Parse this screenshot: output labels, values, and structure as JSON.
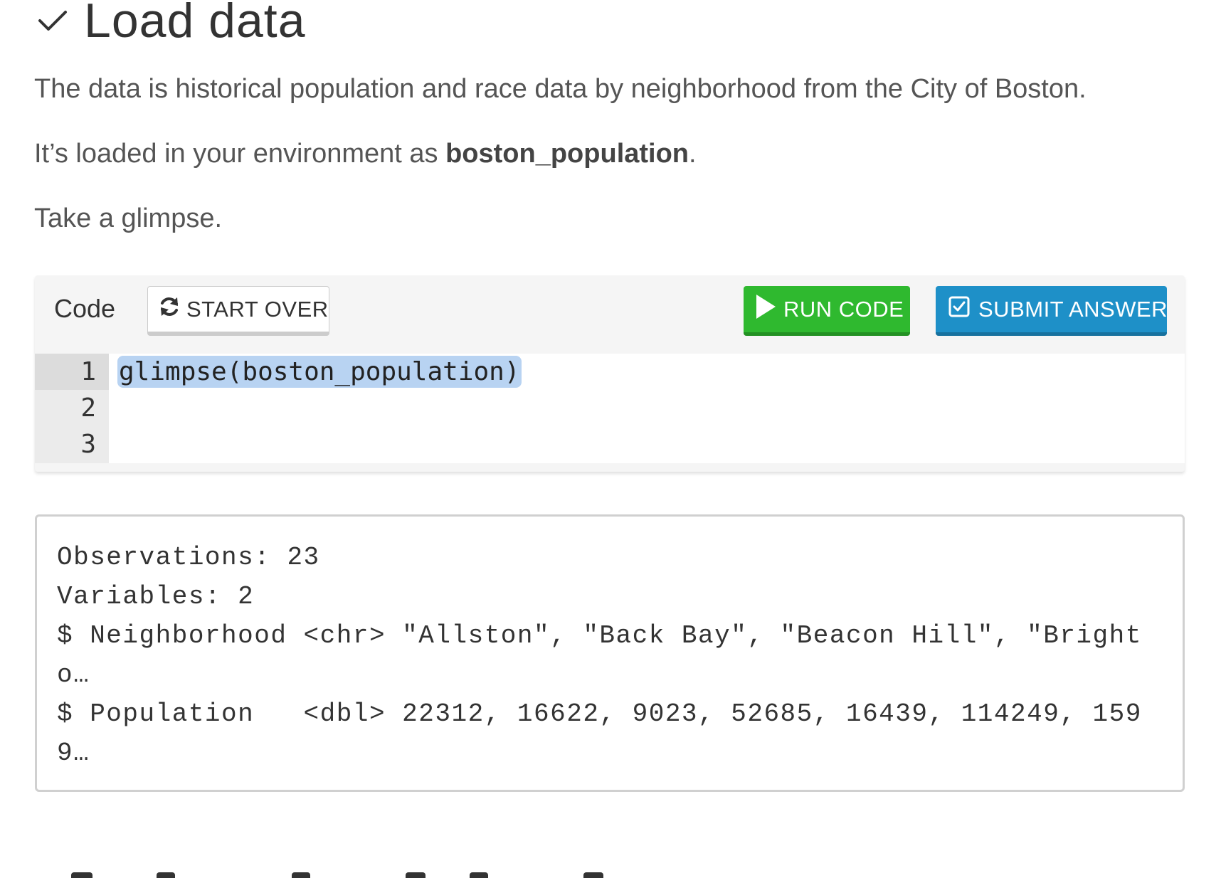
{
  "section": {
    "title": "Load data",
    "check_icon": "check-icon"
  },
  "paragraphs": {
    "p1": "The data is historical population and race data by neighborhood from the City of Boston.",
    "p2_prefix": "It’s loaded in your environment as ",
    "p2_bold": "boston_population",
    "p2_suffix": ".",
    "p3": "Take a glimpse."
  },
  "exercise": {
    "code_label": "Code",
    "start_over_label": "START OVER",
    "start_over_icon": "refresh-icon",
    "run_label": "RUN CODE",
    "run_icon": "play-icon",
    "submit_label": "SUBMIT ANSWER",
    "submit_icon": "checkbox-icon",
    "line_numbers": [
      "1",
      "2",
      "3"
    ],
    "code": "glimpse(boston_population)",
    "colors": {
      "run": "#2fb92f",
      "submit": "#1e90c8",
      "selection": "#b8d3f2"
    }
  },
  "output": {
    "line1": "Observations: 23",
    "line2": "Variables: 2",
    "line3": "$ Neighborhood <chr> \"Allston\", \"Back Bay\", \"Beacon Hill\", \"Brighto…",
    "line4": "$ Population   <dbl> 22312, 16622, 9023, 52685, 16439, 114249, 1599…"
  }
}
